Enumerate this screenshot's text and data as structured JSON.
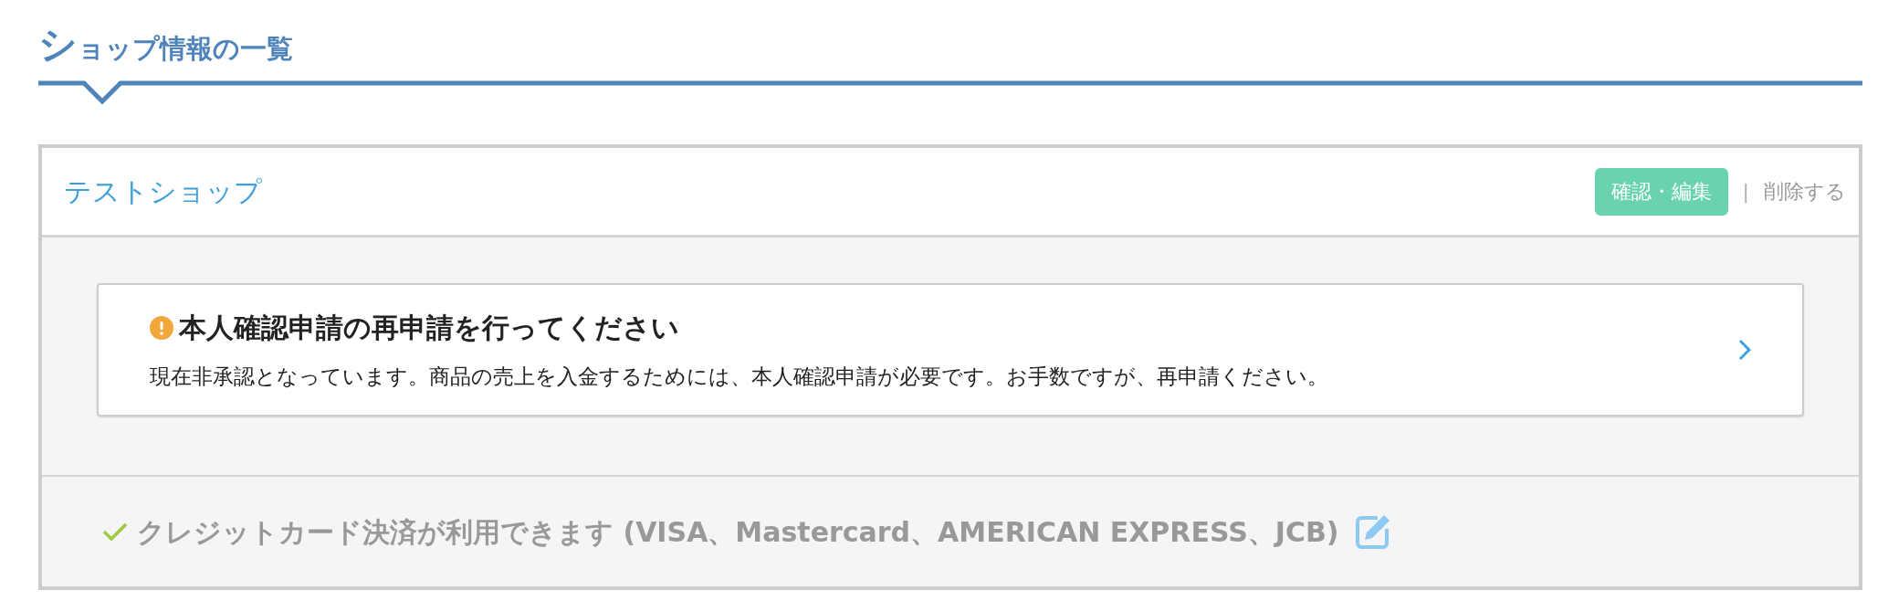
{
  "page_title": "ショップ情報の一覧",
  "shop": {
    "name": "テストショップ",
    "edit_button": "確認・編集",
    "separator": "|",
    "delete_link": "削除する",
    "notice": {
      "title": "本人確認申請の再申請を行ってください",
      "message": "現在非承認となっています。商品の売上を入金するためには、本人確認申請が必要です。お手数ですが、再申請ください。"
    },
    "payment": {
      "text": "クレジットカード決済が利用できます (VISA、Mastercard、AMERICAN EXPRESS、JCB)"
    }
  }
}
